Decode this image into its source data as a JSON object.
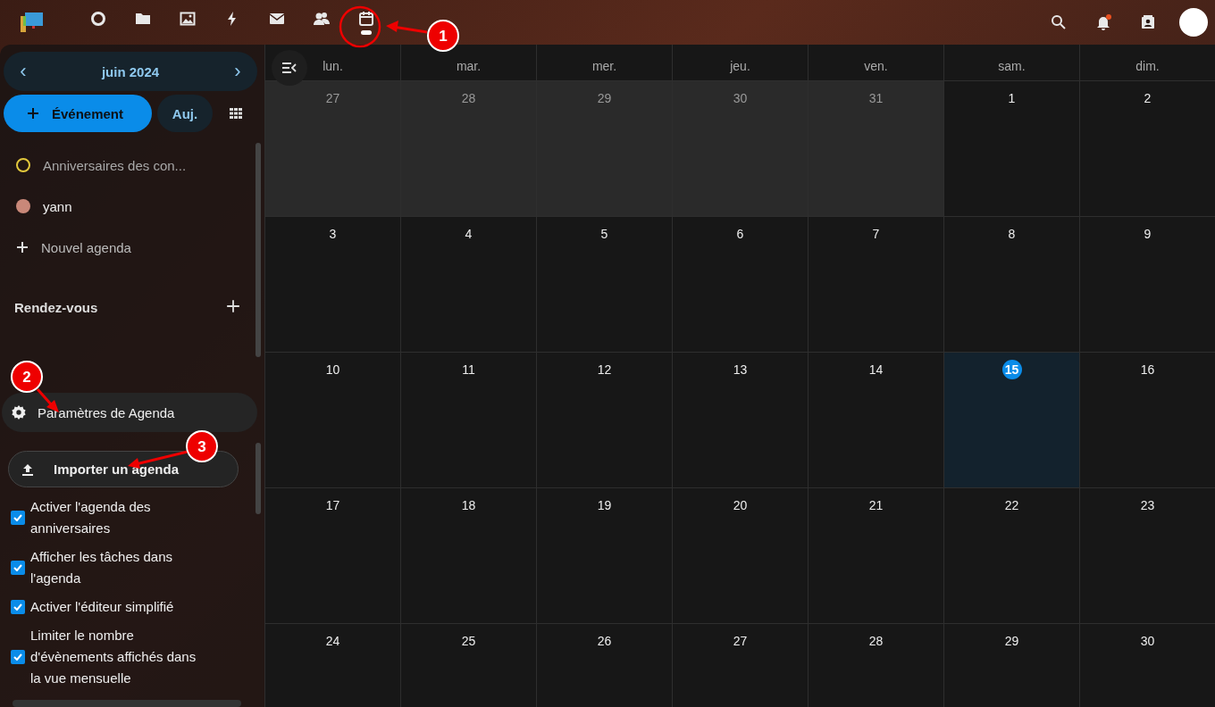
{
  "topbar": {
    "apps": [
      {
        "kind": "circle",
        "selected": false
      },
      {
        "kind": "folder",
        "selected": false
      },
      {
        "kind": "image",
        "selected": false
      },
      {
        "kind": "bolt",
        "selected": false
      },
      {
        "kind": "mail",
        "selected": false
      },
      {
        "kind": "people",
        "selected": false
      },
      {
        "kind": "calendar",
        "selected": true
      }
    ],
    "notifications_unread": true
  },
  "sidebar": {
    "month": "juin 2024",
    "prev": "‹",
    "next": "›",
    "new_event": "Événement",
    "today": "Auj.",
    "calendars": [
      {
        "name": "Anniversaires des con...",
        "color": "#e2c83c",
        "enabled": false
      },
      {
        "name": "yann",
        "color": "#c98879",
        "enabled": true
      }
    ],
    "new_calendar": "Nouvel agenda",
    "appointments": "Rendez-vous",
    "settings": "Paramètres de Agenda",
    "import": "Importer un agenda",
    "options": [
      {
        "label": "Activer l'agenda des anniversaires",
        "checked": true
      },
      {
        "label": "Afficher les tâches dans l'agenda",
        "checked": true
      },
      {
        "label": "Activer l'éditeur simplifié",
        "checked": true
      },
      {
        "label": "Limiter le nombre d'évènements affichés dans la vue mensuelle",
        "checked": true
      }
    ]
  },
  "calendar": {
    "weekdays": [
      "lun.",
      "mar.",
      "mer.",
      "jeu.",
      "ven.",
      "sam.",
      "dim."
    ],
    "weeks": [
      [
        {
          "day": "27",
          "outside_month": true,
          "today": false
        },
        {
          "day": "28",
          "outside_month": true,
          "today": false
        },
        {
          "day": "29",
          "outside_month": true,
          "today": false
        },
        {
          "day": "30",
          "outside_month": true,
          "today": false
        },
        {
          "day": "31",
          "outside_month": true,
          "today": false
        },
        {
          "day": "1",
          "outside_month": false,
          "today": false
        },
        {
          "day": "2",
          "outside_month": false,
          "today": false
        }
      ],
      [
        {
          "day": "3",
          "outside_month": false,
          "today": false
        },
        {
          "day": "4",
          "outside_month": false,
          "today": false
        },
        {
          "day": "5",
          "outside_month": false,
          "today": false
        },
        {
          "day": "6",
          "outside_month": false,
          "today": false
        },
        {
          "day": "7",
          "outside_month": false,
          "today": false
        },
        {
          "day": "8",
          "outside_month": false,
          "today": false
        },
        {
          "day": "9",
          "outside_month": false,
          "today": false
        }
      ],
      [
        {
          "day": "10",
          "outside_month": false,
          "today": false
        },
        {
          "day": "11",
          "outside_month": false,
          "today": false
        },
        {
          "day": "12",
          "outside_month": false,
          "today": false
        },
        {
          "day": "13",
          "outside_month": false,
          "today": false
        },
        {
          "day": "14",
          "outside_month": false,
          "today": false
        },
        {
          "day": "15",
          "outside_month": false,
          "today": true
        },
        {
          "day": "16",
          "outside_month": false,
          "today": false
        }
      ],
      [
        {
          "day": "17",
          "outside_month": false,
          "today": false
        },
        {
          "day": "18",
          "outside_month": false,
          "today": false
        },
        {
          "day": "19",
          "outside_month": false,
          "today": false
        },
        {
          "day": "20",
          "outside_month": false,
          "today": false
        },
        {
          "day": "21",
          "outside_month": false,
          "today": false
        },
        {
          "day": "22",
          "outside_month": false,
          "today": false
        },
        {
          "day": "23",
          "outside_month": false,
          "today": false
        }
      ],
      [
        {
          "day": "24",
          "outside_month": false,
          "today": false
        },
        {
          "day": "25",
          "outside_month": false,
          "today": false
        },
        {
          "day": "26",
          "outside_month": false,
          "today": false
        },
        {
          "day": "27",
          "outside_month": false,
          "today": false
        },
        {
          "day": "28",
          "outside_month": false,
          "today": false
        },
        {
          "day": "29",
          "outside_month": false,
          "today": false
        },
        {
          "day": "30",
          "outside_month": false,
          "today": false
        }
      ]
    ]
  },
  "callouts": [
    "1",
    "2",
    "3"
  ]
}
